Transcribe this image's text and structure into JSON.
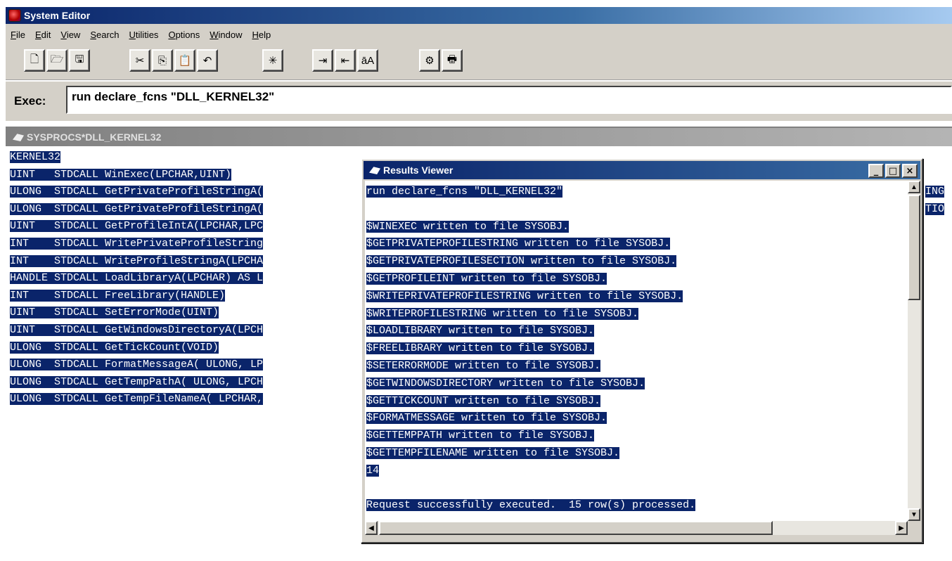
{
  "window": {
    "title": "System Editor"
  },
  "menu": [
    {
      "pre": "",
      "u": "F",
      "post": "ile"
    },
    {
      "pre": "",
      "u": "E",
      "post": "dit"
    },
    {
      "pre": "",
      "u": "V",
      "post": "iew"
    },
    {
      "pre": "",
      "u": "S",
      "post": "earch"
    },
    {
      "pre": "",
      "u": "U",
      "post": "tilities"
    },
    {
      "pre": "",
      "u": "O",
      "post": "ptions"
    },
    {
      "pre": "",
      "u": "W",
      "post": "indow"
    },
    {
      "pre": "",
      "u": "H",
      "post": "elp"
    }
  ],
  "toolbar": {
    "buttons": [
      {
        "name": "new-file-button",
        "icon": "new-file-icon",
        "glyph": "🗋"
      },
      {
        "name": "open-file-button",
        "icon": "open-folder-icon",
        "glyph": "🗁"
      },
      {
        "name": "save-button",
        "icon": "floppy-disk-icon",
        "glyph": "🖫"
      },
      {
        "name": "cut-button",
        "icon": "scissors-icon",
        "glyph": "✂"
      },
      {
        "name": "copy-button",
        "icon": "copy-icon",
        "glyph": "⎘"
      },
      {
        "name": "paste-button",
        "icon": "clipboard-icon",
        "glyph": "📋"
      },
      {
        "name": "undo-button",
        "icon": "undo-icon",
        "glyph": "↶"
      },
      {
        "name": "execute-button",
        "icon": "sparkle-icon",
        "glyph": "✳"
      },
      {
        "name": "indent-button",
        "icon": "indent-icon",
        "glyph": "⇥"
      },
      {
        "name": "outdent-button",
        "icon": "outdent-icon",
        "glyph": "⇤"
      },
      {
        "name": "uppercase-button",
        "icon": "case-toggle-icon",
        "glyph": "āA"
      },
      {
        "name": "preview-button",
        "icon": "preview-icon",
        "glyph": "⚙"
      },
      {
        "name": "print-button",
        "icon": "printer-icon",
        "glyph": "🖶"
      }
    ]
  },
  "exec": {
    "label": "Exec:",
    "value": "run declare_fcns \"DLL_KERNEL32\""
  },
  "editor": {
    "title": "SYSPROCS*DLL_KERNEL32",
    "lines": [
      "KERNEL32",
      "UINT   STDCALL WinExec(LPCHAR,UINT)",
      "ULONG  STDCALL GetPrivateProfileStringA(",
      "ULONG  STDCALL GetPrivateProfileStringA(",
      "UINT   STDCALL GetProfileIntA(LPCHAR,LPC",
      "INT    STDCALL WritePrivateProfileString",
      "INT    STDCALL WriteProfileStringA(LPCHA",
      "HANDLE STDCALL LoadLibraryA(LPCHAR) AS L",
      "INT    STDCALL FreeLibrary(HANDLE)",
      "UINT   STDCALL SetErrorMode(UINT)",
      "UINT   STDCALL GetWindowsDirectoryA(LPCH",
      "ULONG  STDCALL GetTickCount(VOID)",
      "ULONG  STDCALL FormatMessageA( ULONG, LP",
      "ULONG  STDCALL GetTempPathA( ULONG, LPCH",
      "ULONG  STDCALL GetTempFileNameA( LPCHAR,"
    ],
    "overflow": [
      "ING",
      "TIO"
    ]
  },
  "results": {
    "title": "Results Viewer",
    "lines": [
      "run declare_fcns \"DLL_KERNEL32\"",
      "",
      "$WINEXEC written to file SYSOBJ.",
      "$GETPRIVATEPROFILESTRING written to file SYSOBJ.",
      "$GETPRIVATEPROFILESECTION written to file SYSOBJ.",
      "$GETPROFILEINT written to file SYSOBJ.",
      "$WRITEPRIVATEPROFILESTRING written to file SYSOBJ.",
      "$WRITEPROFILESTRING written to file SYSOBJ.",
      "$LOADLIBRARY written to file SYSOBJ.",
      "$FREELIBRARY written to file SYSOBJ.",
      "$SETERRORMODE written to file SYSOBJ.",
      "$GETWINDOWSDIRECTORY written to file SYSOBJ.",
      "$GETTICKCOUNT written to file SYSOBJ.",
      "$FORMATMESSAGE written to file SYSOBJ.",
      "$GETTEMPPATH written to file SYSOBJ.",
      "$GETTEMPFILENAME written to file SYSOBJ.",
      "14",
      "",
      "Request successfully executed.  15 row(s) processed."
    ],
    "window_buttons": {
      "minimize": "_",
      "maximize": "□",
      "close": "×"
    }
  }
}
